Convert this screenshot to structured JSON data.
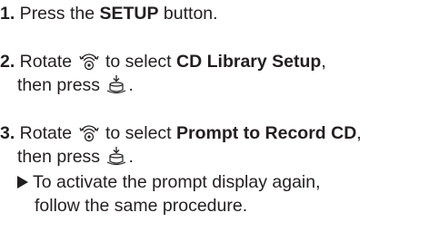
{
  "steps": [
    {
      "number": "1.",
      "pre": " Press the ",
      "bold": "SETUP",
      "post": " button."
    },
    {
      "number": "2.",
      "pre": " Rotate ",
      "mid": " to select ",
      "bold": "CD Library Setup",
      "post": ",",
      "line2_pre": "then press ",
      "line2_post": "."
    },
    {
      "number": "3.",
      "pre": " Rotate ",
      "mid": " to select ",
      "bold": "Prompt to Record CD",
      "post": ",",
      "line2_pre": "then press ",
      "line2_post": ".",
      "note_line1": "To activate the prompt display again,",
      "note_line2": "follow the same procedure."
    }
  ],
  "icons": {
    "rotate": "rotate-knob-icon",
    "press": "press-knob-icon",
    "bullet": "triangle-bullet-icon"
  },
  "colors": {
    "text": "#231f20"
  }
}
